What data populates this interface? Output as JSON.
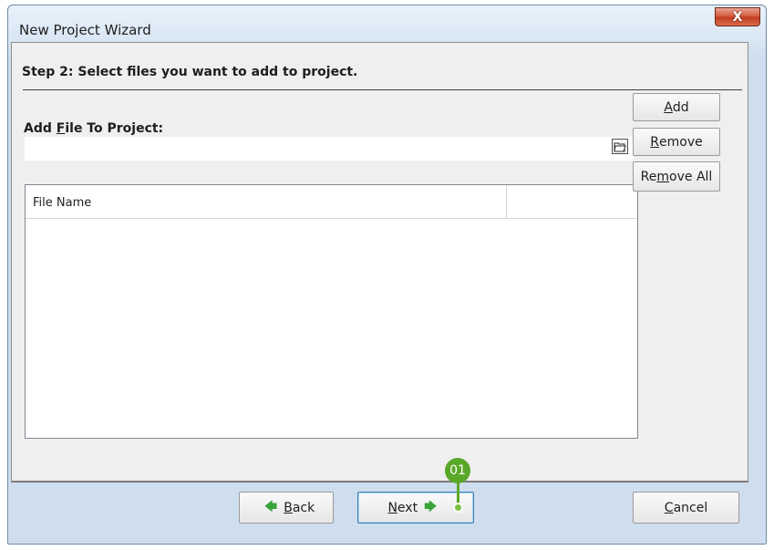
{
  "window": {
    "title": "New Project Wizard",
    "close_glyph": "X"
  },
  "step": {
    "heading": "Step 2: Select files you want to add to project."
  },
  "add_file": {
    "label_prefix": "Add ",
    "label_mnemonic": "F",
    "label_suffix": "ile To Project:",
    "input_value": "",
    "browse_icon": "folder-open-icon"
  },
  "side_buttons": {
    "add_mnemonic": "A",
    "add_rest": "dd",
    "remove_mnemonic": "R",
    "remove_rest": "emove",
    "removeall_prefix": "Re",
    "removeall_mnemonic": "m",
    "removeall_rest": "ove All"
  },
  "file_list": {
    "columns": [
      "File Name",
      ""
    ],
    "rows": []
  },
  "footer": {
    "back_mnemonic": "B",
    "back_rest": "ack",
    "next_mnemonic": "N",
    "next_rest": "ext",
    "cancel_mnemonic": "C",
    "cancel_rest": "ancel"
  },
  "callout": {
    "label": "01",
    "color": "#5aa82a"
  },
  "colors": {
    "close_button": "#d4573c",
    "arrow_green": "#3aa33a",
    "default_button_border": "#3c7fb1"
  }
}
